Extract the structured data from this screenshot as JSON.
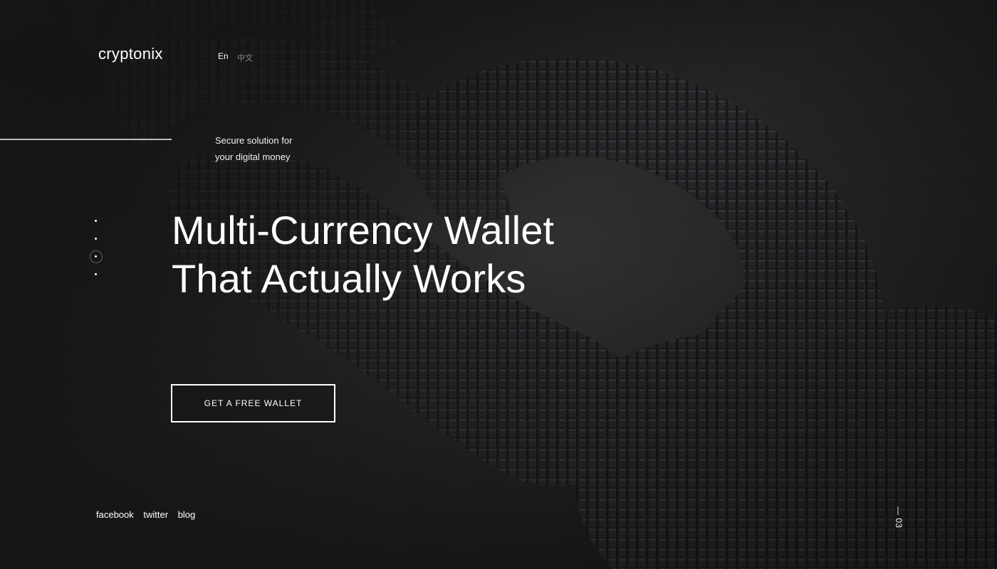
{
  "brand": {
    "logo": "cryptonix"
  },
  "language": {
    "en_label": "En",
    "zh_label": "中文"
  },
  "tagline": {
    "line1": "Secure solution for",
    "line2": "your digital money"
  },
  "slider": {
    "dot_count": 4,
    "active_index": 2
  },
  "hero": {
    "line1": "Multi-Currency Wallet",
    "line2": "That Actually Works",
    "cta_label": "GET A FREE WALLET"
  },
  "social": {
    "facebook": "facebook",
    "twitter": "twitter",
    "blog": "blog"
  },
  "page_indicator": "— 03",
  "colors": {
    "background": "#1b1b1c",
    "text": "#ffffff",
    "muted": "#8a8a8a",
    "chain": "#2a2a2c"
  },
  "background_image": "voxel-chain-links"
}
